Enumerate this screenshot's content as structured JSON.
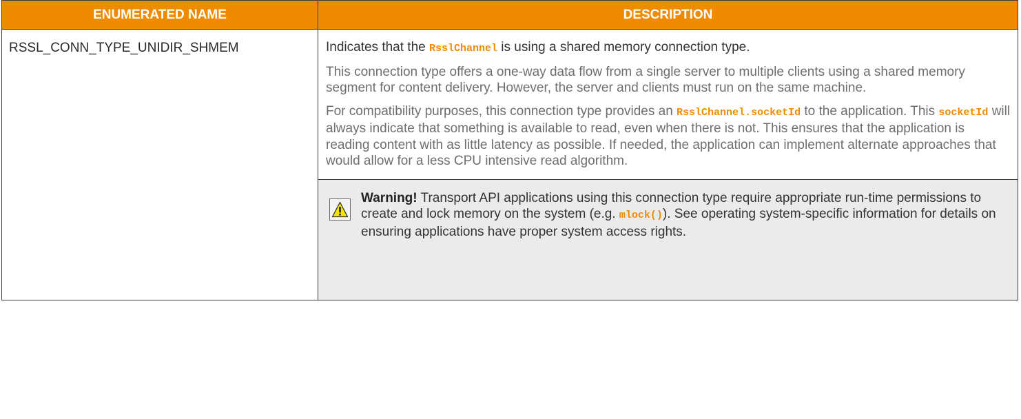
{
  "table": {
    "headers": [
      "ENUMERATED NAME",
      "DESCRIPTION"
    ],
    "row": {
      "name": "RSSL_CONN_TYPE_UNIDIR_SHMEM",
      "p1": {
        "before": "Indicates that the ",
        "code": "RsslChannel",
        "after": " is using a shared memory connection type."
      },
      "p2": "This connection type offers a one-way data flow from a single server to multiple clients using a shared memory segment for content delivery. However, the server and clients must run on the same machine.",
      "p3": {
        "before": "For compatibility purposes, this connection type provides an ",
        "code1": "RsslChannel.socketId",
        "middle": " to the application. This ",
        "code2": "socketId",
        "after": " will always indicate that something is available to read, even when there is not. This ensures that the application is reading content with as little latency as possible. If needed, the application can implement alternate approaches that would allow for a less CPU intensive read algorithm."
      },
      "warning": {
        "icon": "warning-triangle-icon",
        "label": "Warning!",
        "before": " Transport API applications using this connection type require appropriate run-time permissions to create and lock memory on the system (e.g. ",
        "code": "mlock()",
        "after": "). See operating system-specific information for details on ensuring applications have proper system access rights."
      }
    }
  },
  "colors": {
    "header_bg": "#f08a00",
    "code_text": "#f08a00",
    "warning_bg": "#ebebeb",
    "icon_yellow": "#f5e600"
  }
}
